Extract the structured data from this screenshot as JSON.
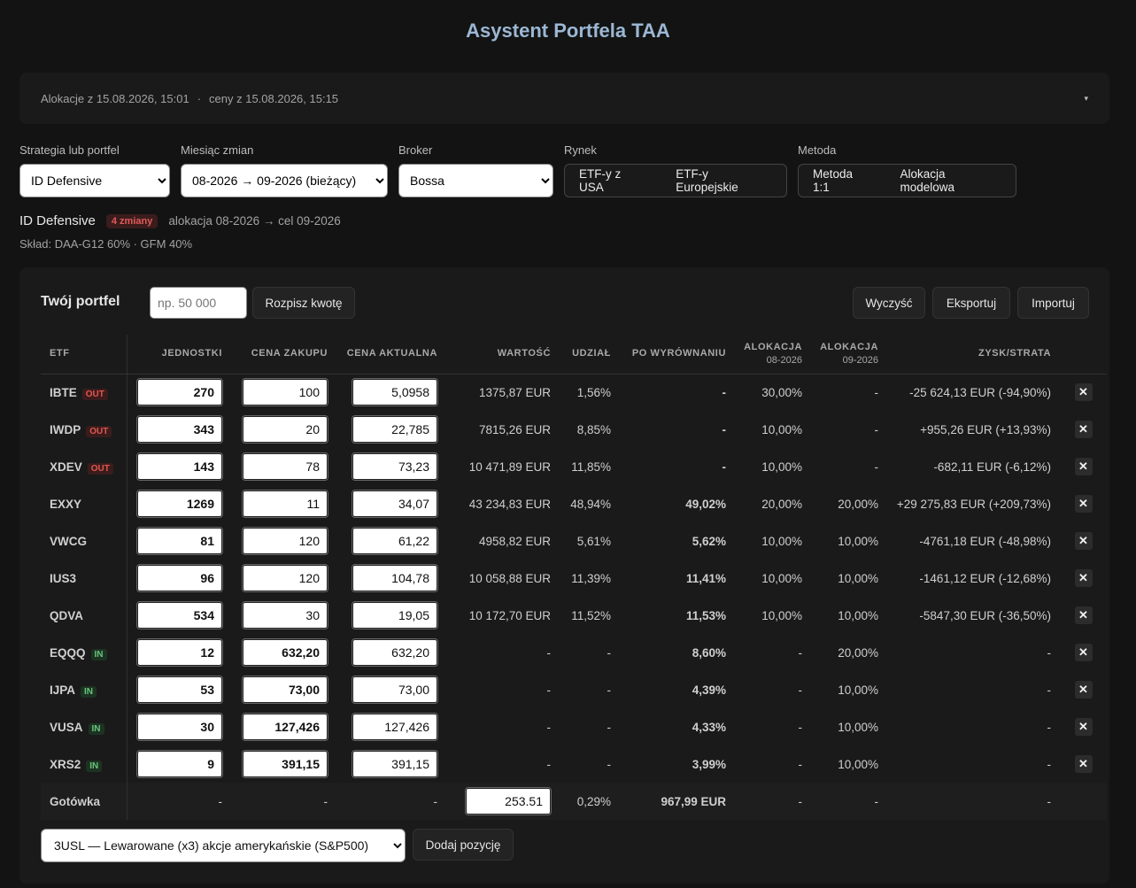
{
  "header": {
    "title": "Asystent Portfela TAA"
  },
  "info": {
    "allocations": "Alokacje z 15.08.2026, 15:01",
    "separator": "·",
    "prices": "ceny z 15.08.2026, 15:15",
    "toggle_icon": "▾"
  },
  "controls": {
    "strategy_label": "Strategia lub portfel",
    "strategy_value": "ID Defensive",
    "month_label": "Miesiąc zmian",
    "month_value": "08-2026 → 09-2026 (bieżący)",
    "broker_label": "Broker",
    "broker_value": "Bossa",
    "market_label": "Rynek",
    "market_options": [
      "ETF-y z USA",
      "ETF-y Europejskie"
    ],
    "method_label": "Metoda",
    "method_options": [
      "Metoda 1:1",
      "Alokacja modelowa"
    ]
  },
  "strategy": {
    "name": "ID Defensive",
    "changes_badge": "4 zmiany",
    "meta": "alokacja 08-2026 → cel 09-2026",
    "composition": "Skład: DAA-G12 60% · GFM 40%"
  },
  "portfolio": {
    "title": "Twój portfel",
    "amount_placeholder": "np. 50 000",
    "split_button": "Rozpisz kwotę",
    "clear_button": "Wyczyść",
    "export_button": "Eksportuj",
    "import_button": "Importuj",
    "columns": {
      "etf": "ETF",
      "units": "JEDNOSTKI",
      "buy_price": "CENA ZAKUPU",
      "current_price": "CENA AKTUALNA",
      "value": "WARTOŚĆ",
      "share": "UDZIAŁ",
      "after": "PO WYRÓWNANIU",
      "alloc1": "ALOKACJA",
      "alloc1_sub": "08-2026",
      "alloc2": "ALOKACJA",
      "alloc2_sub": "09-2026",
      "pl": "ZYSK/STRATA"
    },
    "rows": [
      {
        "etf": "IBTE",
        "tag": "OUT",
        "units": "270",
        "buy": "100",
        "price": "5,0958",
        "value": "1375,87 EUR",
        "share": "1,56%",
        "after": "-",
        "alloc1": "30,00%",
        "alloc2": "-",
        "pl": "-25 624,13 EUR (-94,90%)",
        "pl_sign": "neg"
      },
      {
        "etf": "IWDP",
        "tag": "OUT",
        "units": "343",
        "buy": "20",
        "price": "22,785",
        "value": "7815,26 EUR",
        "share": "8,85%",
        "after": "-",
        "alloc1": "10,00%",
        "alloc2": "-",
        "pl": "+955,26 EUR (+13,93%)",
        "pl_sign": "pos"
      },
      {
        "etf": "XDEV",
        "tag": "OUT",
        "units": "143",
        "buy": "78",
        "price": "73,23",
        "value": "10 471,89 EUR",
        "share": "11,85%",
        "after": "-",
        "alloc1": "10,00%",
        "alloc2": "-",
        "pl": "-682,11 EUR (-6,12%)",
        "pl_sign": "neg"
      },
      {
        "etf": "EXXY",
        "tag": "",
        "units": "1269",
        "buy": "11",
        "price": "34,07",
        "value": "43 234,83 EUR",
        "share": "48,94%",
        "after": "49,02%",
        "alloc1": "20,00%",
        "alloc2": "20,00%",
        "pl": "+29 275,83 EUR (+209,73%)",
        "pl_sign": "pos"
      },
      {
        "etf": "VWCG",
        "tag": "",
        "units": "81",
        "buy": "120",
        "price": "61,22",
        "value": "4958,82 EUR",
        "share": "5,61%",
        "after": "5,62%",
        "alloc1": "10,00%",
        "alloc2": "10,00%",
        "pl": "-4761,18 EUR (-48,98%)",
        "pl_sign": "neg"
      },
      {
        "etf": "IUS3",
        "tag": "",
        "units": "96",
        "buy": "120",
        "price": "104,78",
        "value": "10 058,88 EUR",
        "share": "11,39%",
        "after": "11,41%",
        "alloc1": "10,00%",
        "alloc2": "10,00%",
        "pl": "-1461,12 EUR (-12,68%)",
        "pl_sign": "neg"
      },
      {
        "etf": "QDVA",
        "tag": "",
        "units": "534",
        "buy": "30",
        "price": "19,05",
        "value": "10 172,70 EUR",
        "share": "11,52%",
        "after": "11,53%",
        "alloc1": "10,00%",
        "alloc2": "10,00%",
        "pl": "-5847,30 EUR (-36,50%)",
        "pl_sign": "neg"
      },
      {
        "etf": "EQQQ",
        "tag": "IN",
        "units": "12",
        "buy": "632,20",
        "price": "632,20",
        "value": "-",
        "share": "-",
        "after": "8,60%",
        "alloc1": "-",
        "alloc2": "20,00%",
        "pl": "-",
        "pl_sign": "none"
      },
      {
        "etf": "IJPA",
        "tag": "IN",
        "units": "53",
        "buy": "73,00",
        "price": "73,00",
        "value": "-",
        "share": "-",
        "after": "4,39%",
        "alloc1": "-",
        "alloc2": "10,00%",
        "pl": "-",
        "pl_sign": "none"
      },
      {
        "etf": "VUSA",
        "tag": "IN",
        "units": "30",
        "buy": "127,426",
        "price": "127,426",
        "value": "-",
        "share": "-",
        "after": "4,33%",
        "alloc1": "-",
        "alloc2": "10,00%",
        "pl": "-",
        "pl_sign": "none"
      },
      {
        "etf": "XRS2",
        "tag": "IN",
        "units": "9",
        "buy": "391,15",
        "price": "391,15",
        "value": "-",
        "share": "-",
        "after": "3,99%",
        "alloc1": "-",
        "alloc2": "10,00%",
        "pl": "-",
        "pl_sign": "none"
      }
    ],
    "remove_icon": "✕",
    "cash": {
      "label": "Gotówka",
      "units": "-",
      "buy": "-",
      "price": "-",
      "value": "253.51",
      "share": "0,29%",
      "after": "967,99 EUR",
      "alloc1": "-",
      "alloc2": "-",
      "pl": "-"
    },
    "add_select_value": "3USL — Lewarowane (x3) akcje amerykańskie (S&P500)",
    "add_button": "Dodaj pozycję"
  },
  "colors": {
    "background": "#131313",
    "panel": "#1a1a1a",
    "title": "#9bb7d4",
    "accent_blue": "#5e9be0",
    "positive": "#62c46f",
    "negative": "#e0504a"
  }
}
